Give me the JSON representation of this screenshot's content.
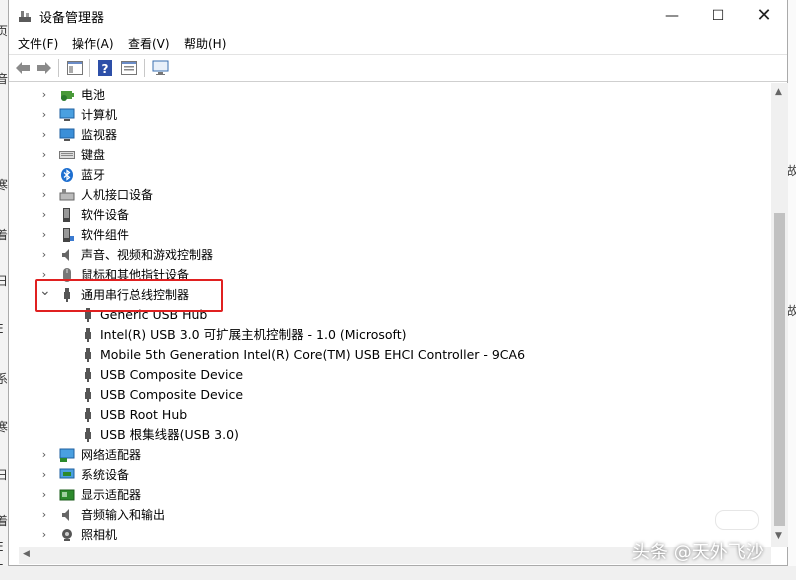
{
  "window": {
    "title": "设备管理器",
    "minimize": "—",
    "maximize": "☐",
    "close": "✕"
  },
  "menu": [
    "文件(F)",
    "操作(A)",
    "查看(V)",
    "帮助(H)"
  ],
  "categories_top": [
    {
      "label": "电池",
      "icon": "battery-icon"
    },
    {
      "label": "计算机",
      "icon": "computer-icon"
    },
    {
      "label": "监视器",
      "icon": "monitor-icon"
    },
    {
      "label": "键盘",
      "icon": "keyboard-icon"
    },
    {
      "label": "蓝牙",
      "icon": "bluetooth-icon"
    },
    {
      "label": "人机接口设备",
      "icon": "hid-icon"
    },
    {
      "label": "软件设备",
      "icon": "software-device-icon"
    },
    {
      "label": "软件组件",
      "icon": "software-component-icon"
    },
    {
      "label": "声音、视频和游戏控制器",
      "icon": "speaker-icon"
    },
    {
      "label": "鼠标和其他指针设备",
      "icon": "mouse-icon"
    }
  ],
  "expanded_category": {
    "label": "通用串行总线控制器",
    "expand_symbol": "⌄"
  },
  "usb_children": [
    "Generic USB Hub",
    "Intel(R) USB 3.0 可扩展主机控制器 - 1.0 (Microsoft)",
    "Mobile 5th Generation Intel(R) Core(TM) USB EHCI Controller - 9CA6",
    "USB Composite Device",
    "USB Composite Device",
    "USB Root Hub",
    "USB 根集线器(USB 3.0)"
  ],
  "categories_bottom": [
    {
      "label": "网络适配器",
      "icon": "network-adapter-icon"
    },
    {
      "label": "系统设备",
      "icon": "system-device-icon"
    },
    {
      "label": "显示适配器",
      "icon": "display-adapter-icon"
    },
    {
      "label": "音频输入和输出",
      "icon": "audio-icon"
    },
    {
      "label": "照相机",
      "icon": "camera-icon"
    }
  ],
  "chevron": "›",
  "watermark": "头条 @天外飞沙",
  "left_edge_fragments": [
    "页",
    "音",
    "寒",
    "着",
    "日",
    "E",
    "系",
    "寒",
    "日",
    "着",
    "E",
    "E"
  ],
  "right_edge_fragments": [
    "故",
    "故"
  ],
  "highlight_color": "#e02020"
}
